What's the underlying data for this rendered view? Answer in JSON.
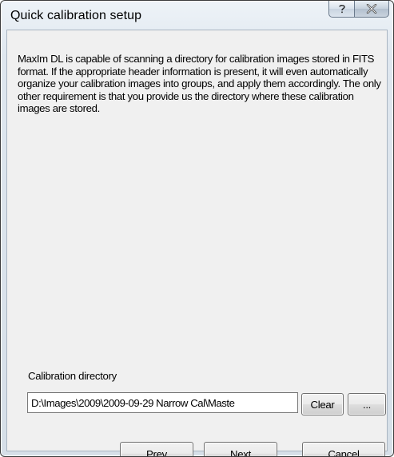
{
  "window": {
    "title": "Quick calibration setup",
    "help_icon": "question-mark-icon",
    "close_icon": "close-x-icon"
  },
  "content": {
    "description": "MaxIm DL is capable of scanning a directory for calibration images stored in FITS format. If the appropriate header information is present, it will even automatically organize your calibration images into groups, and apply them accordingly. The only other requirement is that you provide us the directory where these calibration images are stored.",
    "directory_label": "Calibration directory",
    "directory_value": "D:\\Images\\2009\\2009-09-29 Narrow Cal\\Maste",
    "clear_label": "Clear",
    "browse_label": "..."
  },
  "footer": {
    "prev_label": "Prev",
    "next_label": "Next",
    "cancel_label": "Cancel"
  }
}
